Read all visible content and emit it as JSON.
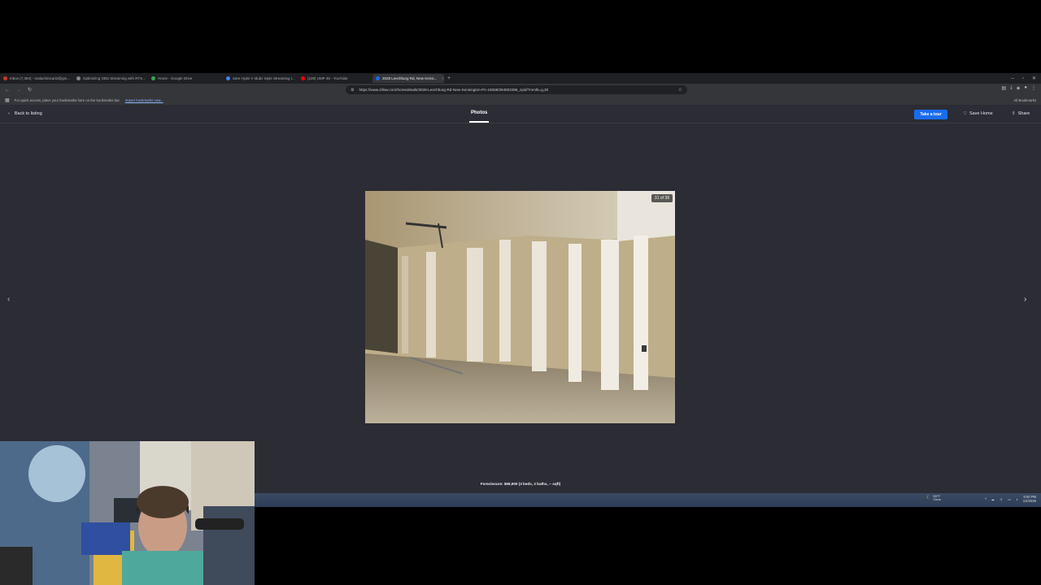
{
  "browser": {
    "tabs": [
      {
        "label": "Inbox (7,384) - malachinicart3@gm...",
        "color": "#d93025",
        "active": false
      },
      {
        "label": "Optimizing OBS Streaming with RTX...",
        "color": "#888888",
        "active": false
      },
      {
        "label": "Home - Google Drive",
        "color": "#34a853",
        "active": false
      },
      {
        "label": "Sam Hyde V Idubz Style Streaming I...",
        "color": "#4285f4",
        "active": false
      },
      {
        "label": "(108) UMP 45 - YouTube",
        "color": "#ff0000",
        "active": false
      },
      {
        "label": "3028 Leechburg Rd, New Kensi...",
        "color": "#1a6cf0",
        "active": true
      }
    ],
    "new_tab": "+",
    "url": "https://www.zillow.com/homedetails/3028-Leechburg-Rd-New-Kensington-PA-15068/294903396_zpid/?mmlb=g,30",
    "bookmarks_hint": "For quick access, place your bookmarks here on the bookmarks bar.",
    "bookmarks_link": "Import bookmarks now...",
    "all_bookmarks": "All Bookmarks"
  },
  "viewer": {
    "back_label": "Back to listing",
    "tab_label": "Photos",
    "tour_button": "Take a tour",
    "save_label": "Save Home",
    "share_label": "Share",
    "counter": "31 of 38",
    "caption": "Foreclosure: $69,900 (3 beds, 2 baths, -- sqft)",
    "icons": {
      "back": "chevron-left-icon",
      "heart": "heart-icon",
      "share": "share-icon",
      "prev": "chevron-left-icon",
      "next": "chevron-right-icon"
    }
  },
  "taskbar": {
    "weather_temp": "55°F",
    "weather_desc": "Clear",
    "time": "9:00 PM",
    "date": "1/4/2026"
  }
}
